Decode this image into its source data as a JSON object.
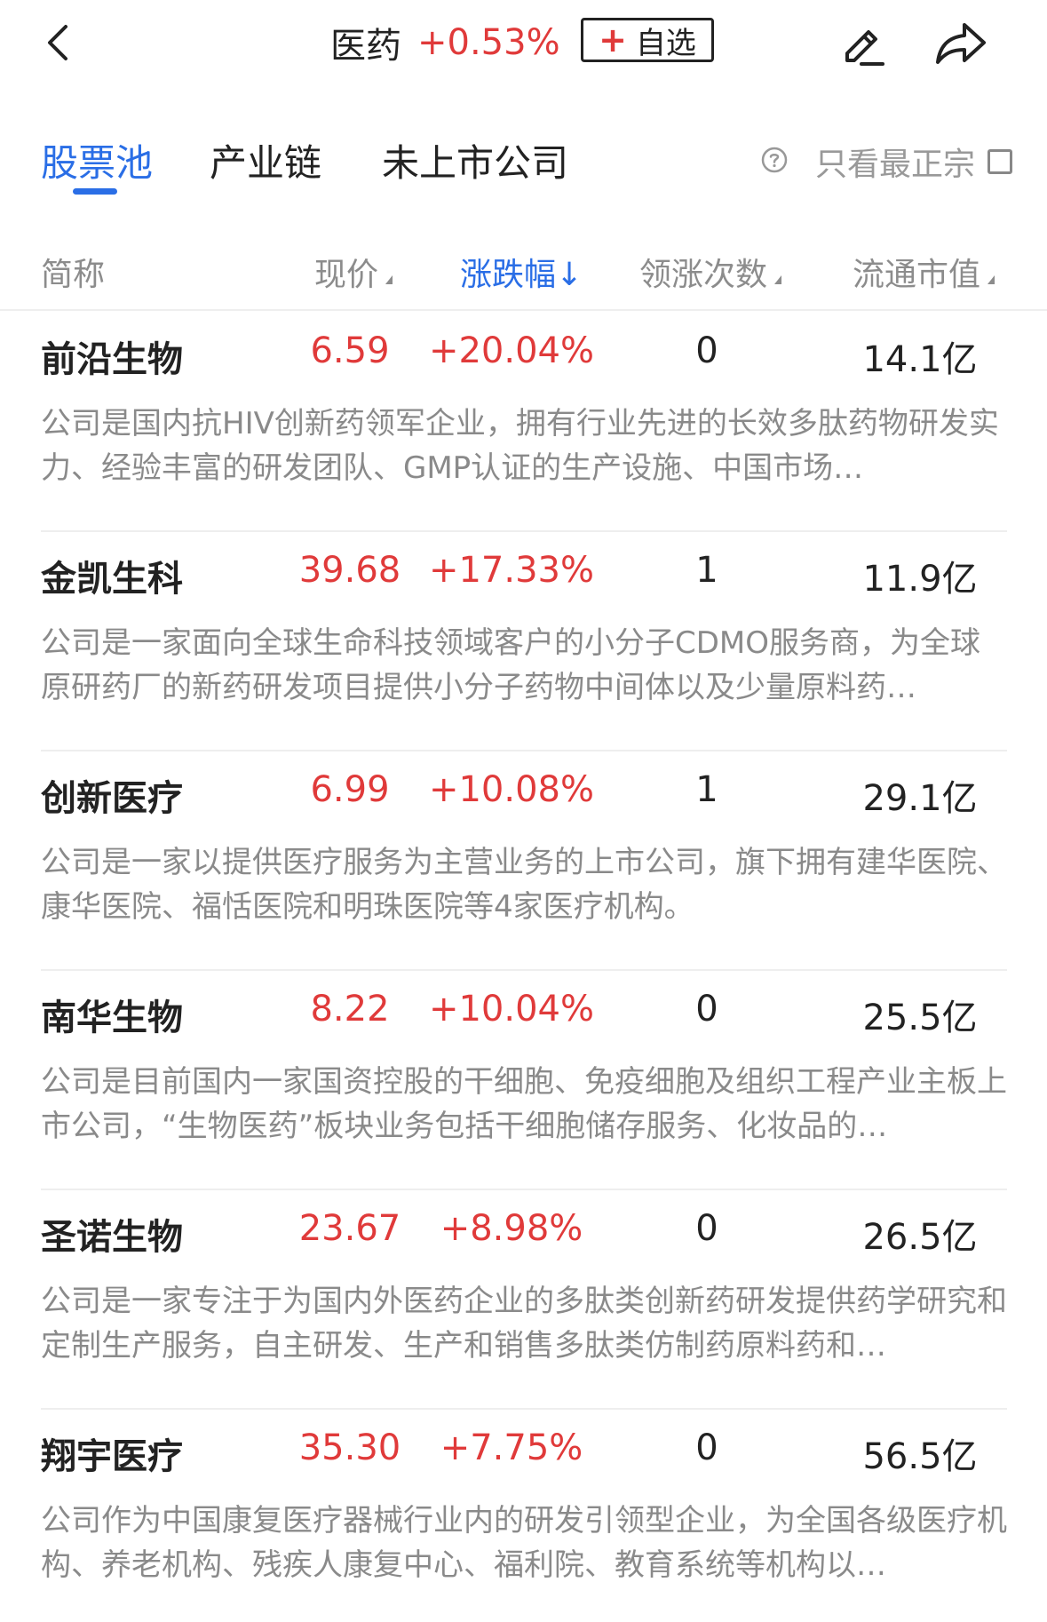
{
  "header": {
    "title": "医药",
    "change": "+0.53%",
    "watch_label": "自选",
    "watch_plus": "+"
  },
  "tabs": [
    {
      "label": "股票池"
    },
    {
      "label": "产业链"
    },
    {
      "label": "未上市公司"
    }
  ],
  "filter": {
    "only_label": "只看最正宗"
  },
  "columns": {
    "name": "简称",
    "price": "现价",
    "change": "涨跌幅↓",
    "times": "领涨次数",
    "cap": "流通市值"
  },
  "rows": [
    {
      "name": "前沿生物",
      "price": "6.59",
      "change": "+20.04%",
      "times": "0",
      "cap": "14.1亿",
      "desc": "公司是国内抗HIV创新药领军企业，拥有行业先进的长效多肽药物研发实力、经验丰富的研发团队、GMP认证的生产设施、中国市场…"
    },
    {
      "name": "金凯生科",
      "price": "39.68",
      "change": "+17.33%",
      "times": "1",
      "cap": "11.9亿",
      "desc": "公司是一家面向全球生命科技领域客户的小分子CDMO服务商，为全球原研药厂的新药研发项目提供小分子药物中间体以及少量原料药…"
    },
    {
      "name": "创新医疗",
      "price": "6.99",
      "change": "+10.08%",
      "times": "1",
      "cap": "29.1亿",
      "desc": "公司是一家以提供医疗服务为主营业务的上市公司，旗下拥有建华医院、康华医院、福恬医院和明珠医院等4家医疗机构。"
    },
    {
      "name": "南华生物",
      "price": "8.22",
      "change": "+10.04%",
      "times": "0",
      "cap": "25.5亿",
      "desc": "公司是目前国内一家国资控股的干细胞、免疫细胞及组织工程产业主板上市公司，“生物医药”板块业务包括干细胞储存服务、化妆品的…"
    },
    {
      "name": "圣诺生物",
      "price": "23.67",
      "change": "+8.98%",
      "times": "0",
      "cap": "26.5亿",
      "desc": "公司是一家专注于为国内外医药企业的多肽类创新药研发提供药学研究和定制生产服务，自主研发、生产和销售多肽类仿制药原料药和…"
    },
    {
      "name": "翔宇医疗",
      "price": "35.30",
      "change": "+7.75%",
      "times": "0",
      "cap": "56.5亿",
      "desc": "公司作为中国康复医疗器械行业内的研发引领型企业，为全国各级医疗机构、养老机构、残疾人康复中心、福利院、教育系统等机构以…"
    }
  ],
  "colors": {
    "accent": "#2a6ee6",
    "up": "#e03a3a",
    "muted": "#8a8a8a"
  }
}
